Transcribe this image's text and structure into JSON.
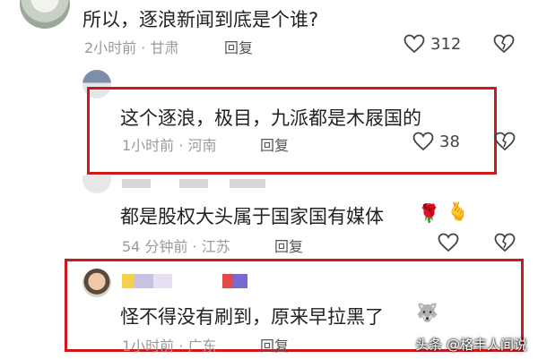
{
  "comments": [
    {
      "text": "所以，逐浪新闻到底是个谁?",
      "time": "2小时前 · 甘肃",
      "reply": "回复",
      "likes": "312"
    },
    {
      "text": "这个逐浪，极目，九派都是木屐国的",
      "time": "1小时前 · 河南",
      "reply": "回复",
      "likes": "38"
    },
    {
      "text": "都是股权大头属于国家国有媒体",
      "time": "54 分钟前 · 江苏",
      "reply": "回复",
      "likes": ""
    },
    {
      "text": "怪不得没有刷到，原来早拉黑了",
      "time": "1小时前 · 广东",
      "reply": "回复",
      "likes": ""
    }
  ],
  "icons": {
    "like": "heart-outline-icon",
    "dislike": "broken-heart-icon",
    "emoji_rose": "🌹",
    "emoji_hand": "🫰",
    "emoji_dog": "🐺"
  },
  "colors": {
    "highlight": "#d01818",
    "meta": "#9a9a9a"
  },
  "watermark": "头条 @格丰人间说"
}
